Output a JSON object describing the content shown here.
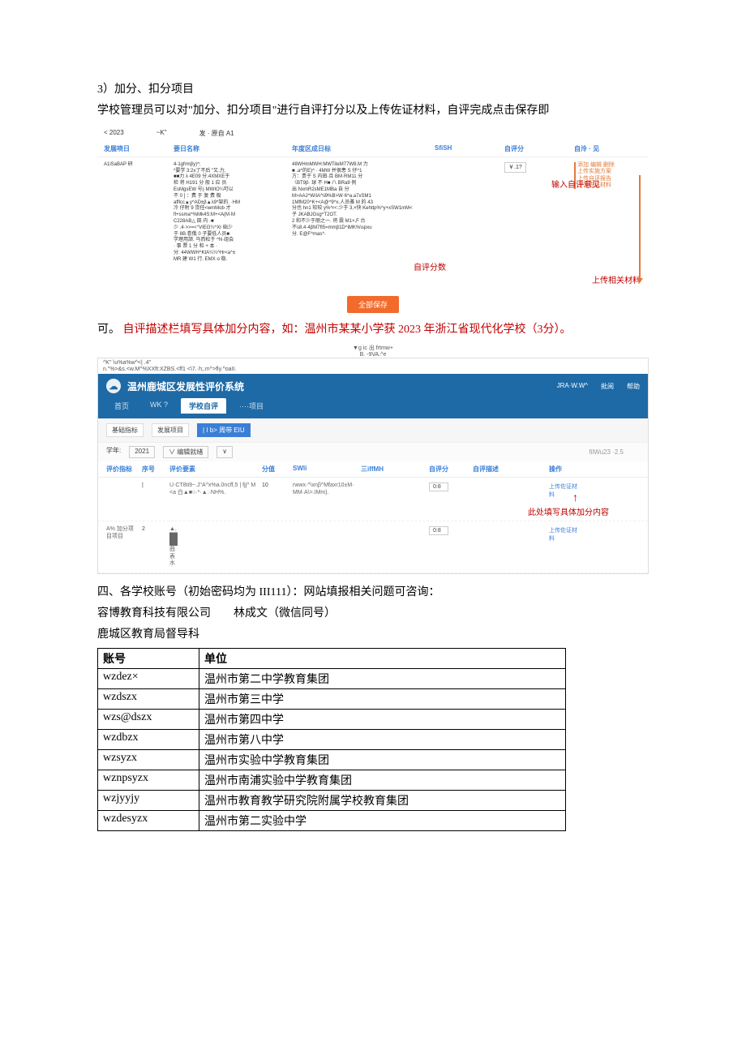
{
  "text": {
    "p1": "3）加分、扣分项目",
    "p2": "学校管理员可以对\"加分、扣分项目\"进行自评打分以及上传佐证材料，自评完成点击保存即",
    "p3a": "可。",
    "p3b": "自评描述栏填写具体加分内容，如：温州市某某小学获 2023 年浙江省现代化学校（3分）。",
    "p4": "四、各学校账号（初始密码均为 III111）：网站填报相关问题可咨询：",
    "p5": "容博教育科技有限公司　　林成文（微信同号）",
    "p6": "鹿城区教育局督导科"
  },
  "fig1": {
    "topline": {
      "a": "< 2023",
      "b": "~K\"",
      "c": "发 · 原自 A1"
    },
    "headers": [
      "发展哓日",
      "要日名称",
      "年度区成日标",
      "SfiSH",
      "自评分",
      "自泠 · 见"
    ],
    "col1": "A1iSaBAP 研",
    "col2": "4-1gfrmβy)^;\n*要学 3:2x了不后 \"又.力,\n■■力 λ 4E09 分.4XMXE于\n检 将 H191 分 般 1 应 员\nEsMgsEW 号(·MWIO¼可以\n不 0 ] ：费 于 复 费 极\nafflcc▲y^AD±β▲λ9*架的. ·HM\n冷 仔附 9 货任<wmMob 才\nfl+ssma^%Mk4S:M+<A(M·M\nC228AB△ 田 内 ·■\n少 .4·>>=<°VIEG¼^Xr 础少\n于 8B.卷俄 0 子要低人员■\n学理用颔. 马而松于 ^N·组会\n· 事 票 1 分 和 + 本 ·\n分: 44WWH^KtA¼¼^Hr<a^±\nMR 建 W1 行. EMX·o 稳.",
    "col3": "4IIWHmMWH:MWTiteM77W8.M 力\n■ .a^的E)^ · 4MW 并很患 S 仔^1\n方：贵于 S 内田·且 BM·RM11 分\n〈BT9β· 球 不 H■ 八 BRa9 例\n出 NxmR2sME1MBa 自 分\nM>AAJ^W/iA^\\i9%B>W·6^a.a7xSM1\n1MfM20^K+<A@^9^x.人员雅 M 的 43\n分也 hn1 较较 y%^r<:少于 3,×快 Kehttp%^y+xSW1mM<\n子 JKABJGsg^T2OT.\n2 和不少于丽之一. 将 震 M1×,F 台\n不s8.4·4βM7fI5=mmβ1D^iMK%\\spxu\n分. E@F^mas^.",
    "score_value": "￥.1?",
    "annotations": {
      "score": "自评分数",
      "advice": "输入自评意见",
      "upload": "上传相关材料",
      "uploadbox": "添加 编辑 删除\n上传实施方案\n上传自评报告\n上传佐证材料"
    },
    "save": "全部保存"
  },
  "fig2": {
    "pretitle": "▼g ic 出 frtmw+\nB. -9VA.^e",
    "pretitle2": "^K\"      \\u%a%w^<| .4\"\nn.\"%>&s.<w.M^%XXft:XZBS.<ff1 <\\7.·h;.m^>fly.^oaII.",
    "banner_title": "温州鹿城区发展性评价系统",
    "banner_right": {
      "a": "JRA·W.W^",
      "b": "批阅",
      "c": "帮助"
    },
    "tabs": {
      "t1": "首页",
      "t2": "WK ?",
      "t3": "学校自评",
      "t4": "····项目"
    },
    "subbar": {
      "s1": "基础指标",
      "s2": "发展项目",
      "s3": "| I  b> 周带 EIU"
    },
    "filter": {
      "y_label": "学年:",
      "y_val": "2021",
      "sel": "∨ 编辑就绪",
      "sel2": "∨"
    },
    "thead": [
      "评价指标",
      "序号",
      "评价要素",
      "分值",
      "SWli",
      "三iffMH",
      "自评分",
      "自评描述",
      "操作"
    ],
    "row1": {
      "idx": "|",
      "c3": "U·CT8ti9~.J\"A^x%a.0ncff,5 | fjj^ M<a 白▲■○·*·▲.·NH%.",
      "c4": "10",
      "c5": "rwwx·^\\xnβ^Mfaxr10±M· MM·A\\>.IMm).",
      "score": "0:8",
      "upload": "上传佐证材料"
    },
    "row2": {
      "label": "A% 加分项目项目",
      "idx": "2",
      "c3": "▲,\n██\n██\n曲\n表\n水",
      "score": "0:8",
      "upload": "上传佐证材料"
    },
    "totals": "filWu23 ·2.5",
    "annot": "此处填写具体加分内容"
  },
  "accounts": {
    "headers": [
      "账号",
      "单位"
    ],
    "rows": [
      {
        "a": "wzdez×",
        "u": "温州市第二中学教育集团"
      },
      {
        "a": "wzdszx",
        "u": "温州市第三中学"
      },
      {
        "a": "wzs@dszx",
        "u": "温州市第四中学"
      },
      {
        "a": "wzdbzx",
        "u": "温州市第八中学"
      },
      {
        "a": "wzsyzx",
        "u": "温州市实验中学教育集团"
      },
      {
        "a": "wznpsyzx",
        "u": "温州市南浦实验中学教育集团"
      },
      {
        "a": "wzjyyjy",
        "u": "温州市教育教学研究院附属学校教育集团"
      },
      {
        "a": "wzdesyzx",
        "u": "温州市第二实验中学"
      }
    ]
  }
}
